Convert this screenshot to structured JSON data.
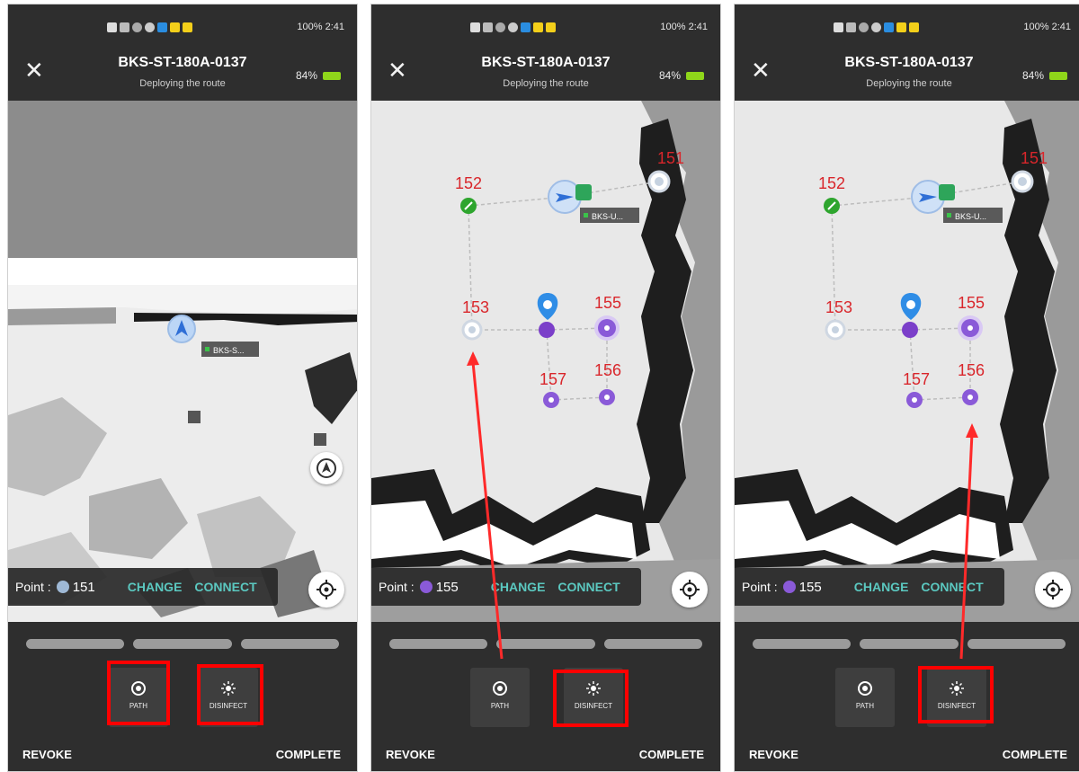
{
  "screens": [
    {
      "status": "100% 2:41",
      "title": "BKS-ST-180A-0137",
      "subtitle": "Deploying the route",
      "battery": "84%",
      "point_label": "Point :",
      "point_value": "151",
      "point_color": "#9fb9d6",
      "change": "CHANGE",
      "connect": "CONNECT",
      "path": "PATH",
      "disinfect": "DISINFECT",
      "revoke": "REVOKE",
      "complete": "COMPLETE",
      "robot_tag": "BKS-S..."
    },
    {
      "status": "100% 2:41",
      "title": "BKS-ST-180A-0137",
      "subtitle": "Deploying the route",
      "battery": "84%",
      "point_label": "Point :",
      "point_value": "155",
      "point_color": "#8a5ad8",
      "change": "CHANGE",
      "connect": "CONNECT",
      "path": "PATH",
      "disinfect": "DISINFECT",
      "revoke": "REVOKE",
      "complete": "COMPLETE",
      "robot_tag": "BKS-U...",
      "points": [
        "152",
        "151",
        "153",
        "155",
        "157",
        "156"
      ]
    },
    {
      "status": "100% 2:41",
      "title": "BKS-ST-180A-0137",
      "subtitle": "Deploying the route",
      "battery": "84%",
      "point_label": "Point :",
      "point_value": "155",
      "point_color": "#8a5ad8",
      "change": "CHANGE",
      "connect": "CONNECT",
      "path": "PATH",
      "disinfect": "DISINFECT",
      "revoke": "REVOKE",
      "complete": "COMPLETE",
      "robot_tag": "BKS-U...",
      "points": [
        "152",
        "151",
        "153",
        "155",
        "157",
        "156"
      ]
    }
  ],
  "colors": {
    "accent_teal": "#5bc8c0",
    "label_red": "#d9262b",
    "highlight_red": "#ff0000",
    "battery_green": "#8fd61a",
    "dark_bg": "#2e2e2e"
  }
}
